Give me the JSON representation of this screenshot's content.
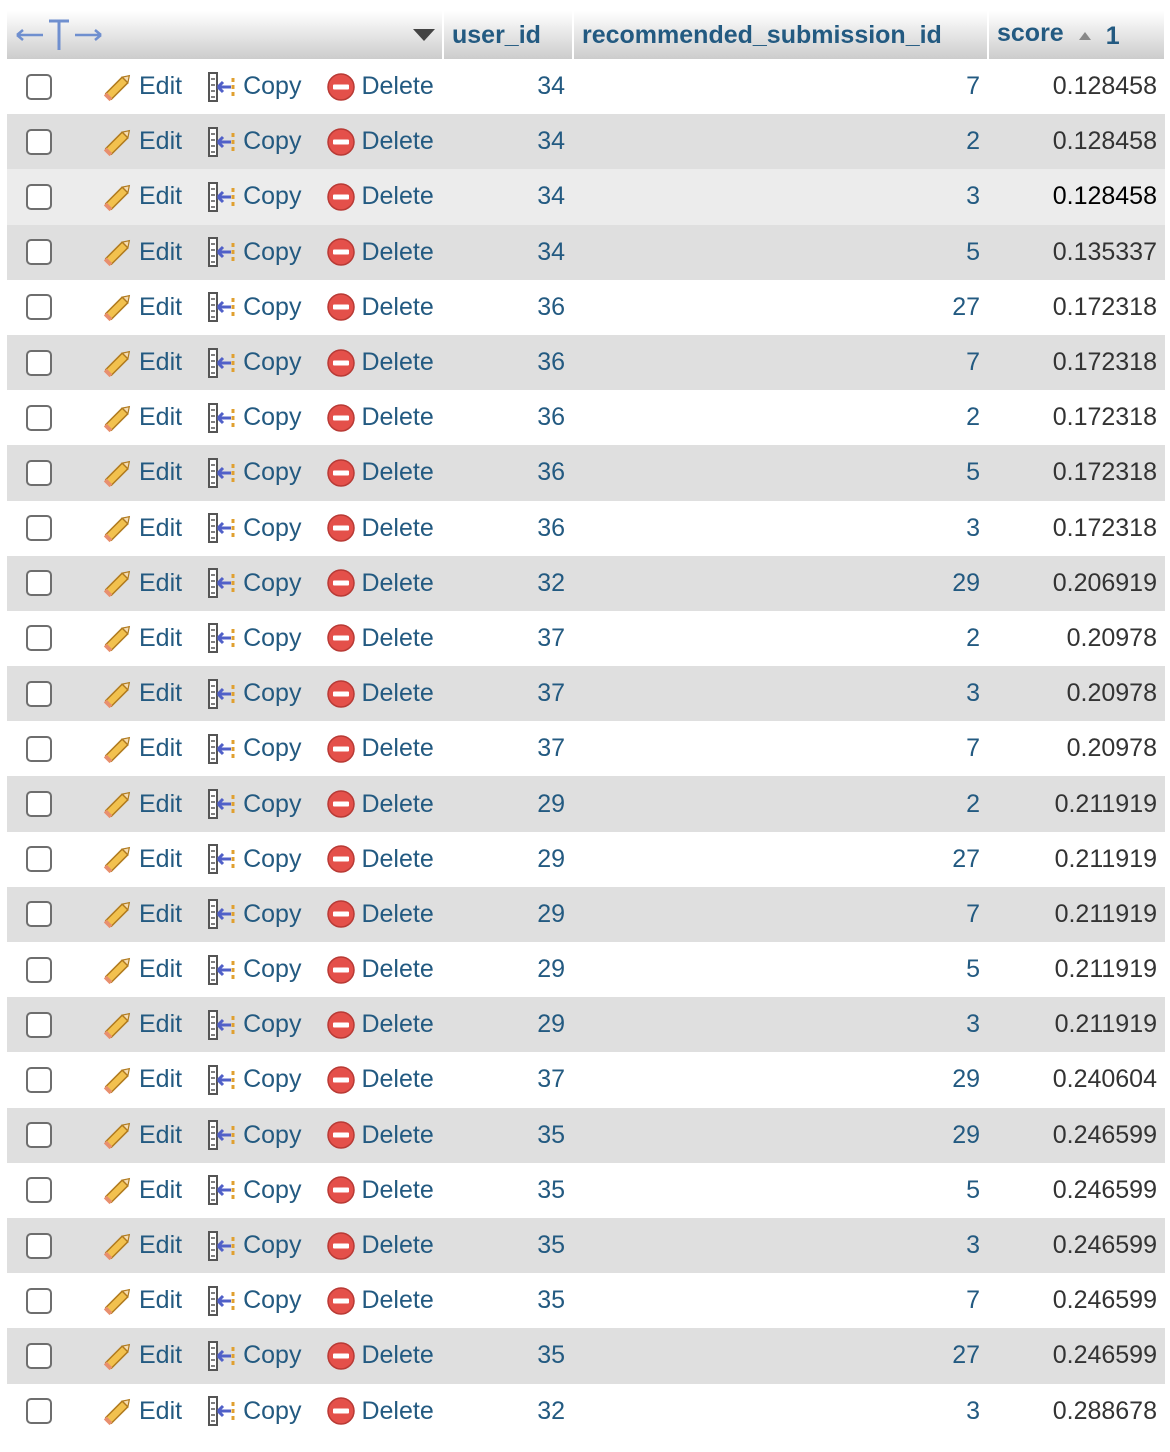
{
  "header": {
    "user_id": "user_id",
    "recommended_submission_id": "recommended_submission_id",
    "score": "score",
    "score_sort_order": "1"
  },
  "actions": {
    "edit": "Edit",
    "copy": "Copy",
    "delete": "Delete"
  },
  "colors": {
    "link": "#235a81",
    "row_alt": "#dfdfdf",
    "delete_icon": "#e4504a",
    "edit_icon": "#e7a53a"
  },
  "rows": [
    {
      "user_id": "34",
      "recommended_submission_id": "7",
      "score": "0.128458"
    },
    {
      "user_id": "34",
      "recommended_submission_id": "2",
      "score": "0.128458"
    },
    {
      "user_id": "34",
      "recommended_submission_id": "3",
      "score": "0.128458"
    },
    {
      "user_id": "34",
      "recommended_submission_id": "5",
      "score": "0.135337"
    },
    {
      "user_id": "36",
      "recommended_submission_id": "27",
      "score": "0.172318"
    },
    {
      "user_id": "36",
      "recommended_submission_id": "7",
      "score": "0.172318"
    },
    {
      "user_id": "36",
      "recommended_submission_id": "2",
      "score": "0.172318"
    },
    {
      "user_id": "36",
      "recommended_submission_id": "5",
      "score": "0.172318"
    },
    {
      "user_id": "36",
      "recommended_submission_id": "3",
      "score": "0.172318"
    },
    {
      "user_id": "32",
      "recommended_submission_id": "29",
      "score": "0.206919"
    },
    {
      "user_id": "37",
      "recommended_submission_id": "2",
      "score": "0.20978"
    },
    {
      "user_id": "37",
      "recommended_submission_id": "3",
      "score": "0.20978"
    },
    {
      "user_id": "37",
      "recommended_submission_id": "7",
      "score": "0.20978"
    },
    {
      "user_id": "29",
      "recommended_submission_id": "2",
      "score": "0.211919"
    },
    {
      "user_id": "29",
      "recommended_submission_id": "27",
      "score": "0.211919"
    },
    {
      "user_id": "29",
      "recommended_submission_id": "7",
      "score": "0.211919"
    },
    {
      "user_id": "29",
      "recommended_submission_id": "5",
      "score": "0.211919"
    },
    {
      "user_id": "29",
      "recommended_submission_id": "3",
      "score": "0.211919"
    },
    {
      "user_id": "37",
      "recommended_submission_id": "29",
      "score": "0.240604"
    },
    {
      "user_id": "35",
      "recommended_submission_id": "29",
      "score": "0.246599"
    },
    {
      "user_id": "35",
      "recommended_submission_id": "5",
      "score": "0.246599"
    },
    {
      "user_id": "35",
      "recommended_submission_id": "3",
      "score": "0.246599"
    },
    {
      "user_id": "35",
      "recommended_submission_id": "7",
      "score": "0.246599"
    },
    {
      "user_id": "35",
      "recommended_submission_id": "27",
      "score": "0.246599"
    },
    {
      "user_id": "32",
      "recommended_submission_id": "3",
      "score": "0.288678"
    }
  ]
}
